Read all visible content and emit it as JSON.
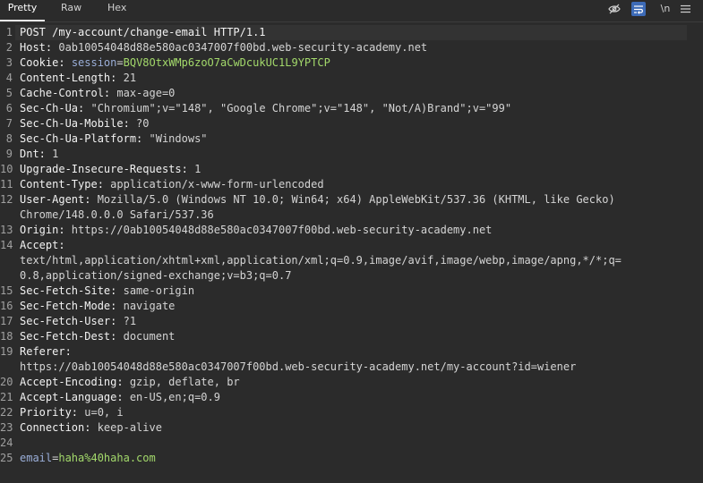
{
  "tabs": [
    {
      "label": "Pretty",
      "active": true
    },
    {
      "label": "Raw",
      "active": false
    },
    {
      "label": "Hex",
      "active": false
    }
  ],
  "toolbar": {
    "newline_label": "\\n",
    "icons": [
      "eye-slash-icon",
      "wrap-lines-icon",
      "newline-icon",
      "hamburger-menu-icon"
    ]
  },
  "colors": {
    "header_key": "#f2f2f2",
    "param_name": "#9aaed8",
    "param_value": "#a3d96b",
    "accent": "#3d6bb7"
  },
  "request_lines": [
    {
      "num": "1",
      "visual": [
        [
          {
            "t": "POST /my-account/change-email HTTP/1.1",
            "c": "k"
          }
        ]
      ]
    },
    {
      "num": "2",
      "visual": [
        [
          {
            "t": "Host:",
            "c": "k"
          },
          {
            "t": " 0ab10054048d88e580ac0347007f00bd.web-security-academy.net",
            "c": "v"
          }
        ]
      ]
    },
    {
      "num": "3",
      "visual": [
        [
          {
            "t": "Cookie:",
            "c": "k"
          },
          {
            "t": " ",
            "c": "v"
          },
          {
            "t": "session",
            "c": "p"
          },
          {
            "t": "=",
            "c": "v"
          },
          {
            "t": "BQV8OtxWMp6zoO7aCwDcukUC1L9YPTCP",
            "c": "cv"
          }
        ]
      ]
    },
    {
      "num": "4",
      "visual": [
        [
          {
            "t": "Content-Length:",
            "c": "k"
          },
          {
            "t": " 21",
            "c": "v"
          }
        ]
      ]
    },
    {
      "num": "5",
      "visual": [
        [
          {
            "t": "Cache-Control:",
            "c": "k"
          },
          {
            "t": " max-age=0",
            "c": "v"
          }
        ]
      ]
    },
    {
      "num": "6",
      "visual": [
        [
          {
            "t": "Sec-Ch-Ua:",
            "c": "k"
          },
          {
            "t": " \"Chromium\";v=\"148\", \"Google Chrome\";v=\"148\", \"Not/A)Brand\";v=\"99\"",
            "c": "v"
          }
        ]
      ]
    },
    {
      "num": "7",
      "visual": [
        [
          {
            "t": "Sec-Ch-Ua-Mobile:",
            "c": "k"
          },
          {
            "t": " ?0",
            "c": "v"
          }
        ]
      ]
    },
    {
      "num": "8",
      "visual": [
        [
          {
            "t": "Sec-Ch-Ua-Platform:",
            "c": "k"
          },
          {
            "t": " \"Windows\"",
            "c": "v"
          }
        ]
      ]
    },
    {
      "num": "9",
      "visual": [
        [
          {
            "t": "Dnt:",
            "c": "k"
          },
          {
            "t": " 1",
            "c": "v"
          }
        ]
      ]
    },
    {
      "num": "10",
      "visual": [
        [
          {
            "t": "Upgrade-Insecure-Requests:",
            "c": "k"
          },
          {
            "t": " 1",
            "c": "v"
          }
        ]
      ]
    },
    {
      "num": "11",
      "visual": [
        [
          {
            "t": "Content-Type:",
            "c": "k"
          },
          {
            "t": " application/x-www-form-urlencoded",
            "c": "v"
          }
        ]
      ]
    },
    {
      "num": "12",
      "visual": [
        [
          {
            "t": "User-Agent:",
            "c": "k"
          },
          {
            "t": " Mozilla/5.0 (Windows NT 10.0; Win64; x64) AppleWebKit/537.36 (KHTML, like Gecko)",
            "c": "v"
          }
        ],
        [
          {
            "t": "Chrome/148.0.0.0 Safari/537.36",
            "c": "v"
          }
        ]
      ]
    },
    {
      "num": "13",
      "visual": [
        [
          {
            "t": "Origin:",
            "c": "k"
          },
          {
            "t": " https://0ab10054048d88e580ac0347007f00bd.web-security-academy.net",
            "c": "v"
          }
        ]
      ]
    },
    {
      "num": "14",
      "visual": [
        [
          {
            "t": "Accept:",
            "c": "k"
          }
        ],
        [
          {
            "t": "text/html,application/xhtml+xml,application/xml;q=0.9,image/avif,image/webp,image/apng,*/*;q=",
            "c": "v"
          }
        ],
        [
          {
            "t": "0.8,application/signed-exchange;v=b3;q=0.7",
            "c": "v"
          }
        ]
      ]
    },
    {
      "num": "15",
      "visual": [
        [
          {
            "t": "Sec-Fetch-Site:",
            "c": "k"
          },
          {
            "t": " same-origin",
            "c": "v"
          }
        ]
      ]
    },
    {
      "num": "16",
      "visual": [
        [
          {
            "t": "Sec-Fetch-Mode:",
            "c": "k"
          },
          {
            "t": " navigate",
            "c": "v"
          }
        ]
      ]
    },
    {
      "num": "17",
      "visual": [
        [
          {
            "t": "Sec-Fetch-User:",
            "c": "k"
          },
          {
            "t": " ?1",
            "c": "v"
          }
        ]
      ]
    },
    {
      "num": "18",
      "visual": [
        [
          {
            "t": "Sec-Fetch-Dest:",
            "c": "k"
          },
          {
            "t": " document",
            "c": "v"
          }
        ]
      ]
    },
    {
      "num": "19",
      "visual": [
        [
          {
            "t": "Referer:",
            "c": "k"
          }
        ],
        [
          {
            "t": "https://0ab10054048d88e580ac0347007f00bd.web-security-academy.net/my-account?id=wiener",
            "c": "v"
          }
        ]
      ]
    },
    {
      "num": "20",
      "visual": [
        [
          {
            "t": "Accept-Encoding:",
            "c": "k"
          },
          {
            "t": " gzip, deflate, br",
            "c": "v"
          }
        ]
      ]
    },
    {
      "num": "21",
      "visual": [
        [
          {
            "t": "Accept-Language:",
            "c": "k"
          },
          {
            "t": " en-US,en;q=0.9",
            "c": "v"
          }
        ]
      ]
    },
    {
      "num": "22",
      "visual": [
        [
          {
            "t": "Priority:",
            "c": "k"
          },
          {
            "t": " u=0, i",
            "c": "v"
          }
        ]
      ]
    },
    {
      "num": "23",
      "visual": [
        [
          {
            "t": "Connection:",
            "c": "k"
          },
          {
            "t": " keep-alive",
            "c": "v"
          }
        ]
      ]
    },
    {
      "num": "24",
      "visual": [
        []
      ]
    },
    {
      "num": "25",
      "visual": [
        [
          {
            "t": "email",
            "c": "p"
          },
          {
            "t": "=",
            "c": "v"
          },
          {
            "t": "haha%40haha.com",
            "c": "cv"
          }
        ]
      ]
    }
  ]
}
